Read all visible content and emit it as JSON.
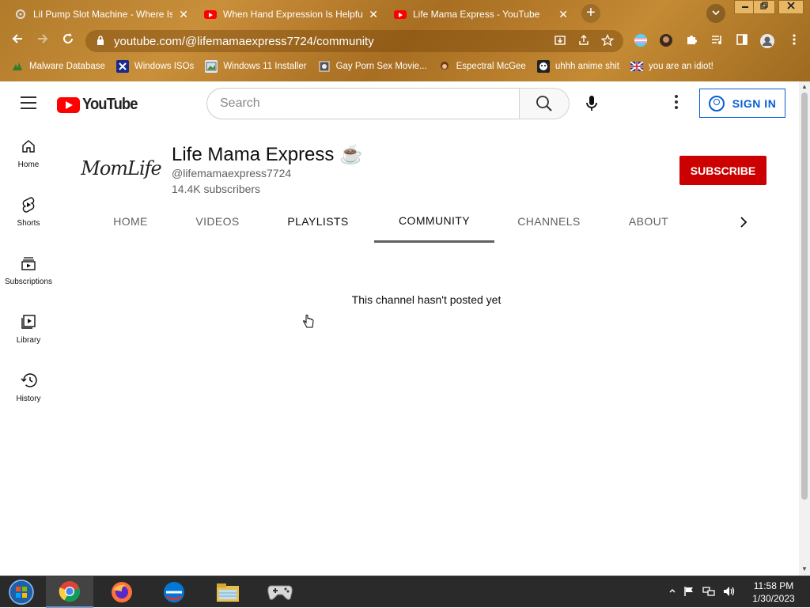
{
  "browser": {
    "tabs": [
      {
        "title": "Lil Pump Slot Machine - Where Is",
        "icon": "slot-icon",
        "active": false
      },
      {
        "title": "When Hand Expression Is Helpful",
        "icon": "youtube-icon",
        "active": false
      },
      {
        "title": "Life Mama Express    - YouTube",
        "icon": "youtube-icon",
        "active": true
      }
    ],
    "close_glyph": "✕",
    "new_tab_glyph": "+",
    "url": "youtube.com/@lifemamaexpress7724/community",
    "bookmarks": [
      {
        "label": "Malware Database",
        "icon": "bug-icon"
      },
      {
        "label": "Windows ISOs",
        "icon": "x-logo-icon"
      },
      {
        "label": "Windows 11 Installer",
        "icon": "image-icon"
      },
      {
        "label": "Gay Porn Sex Movie...",
        "icon": "globe-icon"
      },
      {
        "label": "Espectral McGee",
        "icon": "character-icon"
      },
      {
        "label": "uhhh anime shit",
        "icon": "anime-icon"
      },
      {
        "label": "you are an idiot!",
        "icon": "flag-icon"
      }
    ]
  },
  "youtube": {
    "logo_text": "YouTube",
    "search_placeholder": "Search",
    "sign_in": "SIGN IN",
    "guide": [
      {
        "label": "Home",
        "icon": "home-icon"
      },
      {
        "label": "Shorts",
        "icon": "shorts-icon"
      },
      {
        "label": "Subscriptions",
        "icon": "subscriptions-icon"
      },
      {
        "label": "Library",
        "icon": "library-icon"
      },
      {
        "label": "History",
        "icon": "history-icon"
      }
    ],
    "channel": {
      "avatar_text": "MomLife",
      "name": "Life Mama Express ☕",
      "handle": "@lifemamaexpress7724",
      "subscribers": "14.4K subscribers",
      "subscribe": "SUBSCRIBE"
    },
    "tabs": [
      {
        "label": "HOME",
        "active": false
      },
      {
        "label": "VIDEOS",
        "active": false
      },
      {
        "label": "PLAYLISTS",
        "active": false
      },
      {
        "label": "COMMUNITY",
        "active": true
      },
      {
        "label": "CHANNELS",
        "active": false
      },
      {
        "label": "ABOUT",
        "active": false
      }
    ],
    "empty_message": "This channel hasn't posted yet"
  },
  "taskbar": {
    "apps": [
      "start-orb-icon",
      "chrome-icon",
      "firefox-icon",
      "edge-icon",
      "file-explorer-icon",
      "gamepad-icon"
    ],
    "time": "11:58 PM",
    "date": "1/30/2023"
  },
  "colors": {
    "frame": "#b07a2a",
    "youtube_red": "#ff0000",
    "subscribe_red": "#cc0000",
    "signin_blue": "#065fd4",
    "taskbar": "#2a2a2a"
  }
}
